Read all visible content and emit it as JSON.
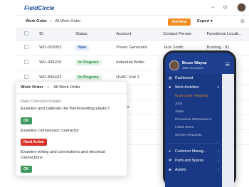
{
  "app": {
    "logo": "FieldCircle",
    "topbar_icons": [
      "+",
      "⚙"
    ],
    "breadcrumb": {
      "root": "Work Order",
      "separator": ">",
      "current": "All Work Order"
    },
    "add_new_label": "Add New",
    "export_label": "Export",
    "export_caret": "▾"
  },
  "table": {
    "columns": [
      "ID",
      "Status",
      "Account",
      "Contact Person",
      "Functional Locati..."
    ],
    "rows": [
      {
        "id": "WO-003953",
        "status": "New",
        "status_type": "new",
        "account": "Power Generator",
        "contact": "Jack Smith",
        "location": "Building - 81"
      },
      {
        "id": "WO-435226",
        "status": "In Progress",
        "status_type": "progress",
        "account": "Industrial Boiler",
        "contact": "Reena",
        "location": ""
      },
      {
        "id": "WO-845423",
        "status": "In Progress",
        "status_type": "progress",
        "account": "HVAC Unit 1",
        "contact": "Reena",
        "location": ""
      },
      {
        "id": "",
        "status": "",
        "status_type": "",
        "account": "",
        "contact": "Andrew",
        "location": ""
      },
      {
        "id": "",
        "status": "",
        "status_type": "",
        "account": "ervices",
        "contact": "Benn",
        "location": ""
      },
      {
        "id": "",
        "status": "",
        "status_type": "",
        "account": "",
        "contact": "Woli F",
        "location": ""
      },
      {
        "id": "",
        "status": "",
        "status_type": "",
        "account": "",
        "contact": "Woli F",
        "location": ""
      }
    ]
  },
  "card": {
    "breadcrumb_root": "Work Order",
    "separator": ">",
    "breadcrumb_current": "All Work Order",
    "section_title": "Main Checklist Details",
    "tasks": [
      {
        "text": "Examine and calibrate the thermosetting plastic?",
        "result": "OK",
        "result_type": "ok"
      },
      {
        "text": "Examine compressor contractor",
        "result": "Need Action",
        "result_type": "action"
      },
      {
        "text": "Examine wiring and connections and electrical connections",
        "result": "OK",
        "result_type": "ok"
      }
    ]
  },
  "phone": {
    "user_name": "Bruce Wayne",
    "user_role": "Sales Executive",
    "nav": {
      "dashboard": "Dashboard",
      "work_activities": "Work Activities",
      "sub_items": [
        "Work Order (Projects)",
        "Jobs",
        "Tasks",
        "Preventive Maintenance",
        "Failed Items",
        "Service Requests"
      ],
      "customer_management": "Customer Manag...",
      "parts_and_spares": "Parts and Spares",
      "assets": "Assets"
    }
  },
  "colors": {
    "accent": "#f28a1e",
    "brand_blue": "#1f4fa0",
    "ok_green": "#3f9a60",
    "danger_red": "#d9342b",
    "phone_nav": "#1a3984"
  },
  "icons": {
    "dashboard": "grid-icon",
    "work_activities": "briefcase-icon",
    "customer_management": "users-icon",
    "parts_and_spares": "wrench-icon",
    "assets": "box-icon"
  }
}
